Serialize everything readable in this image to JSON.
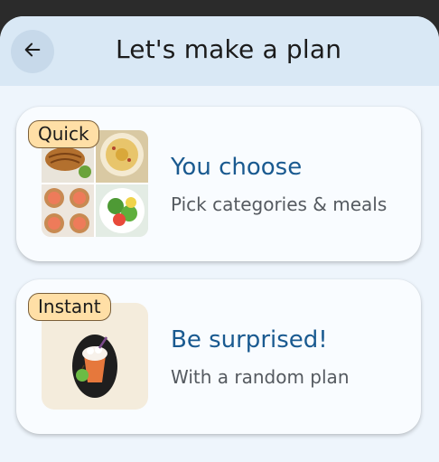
{
  "header": {
    "title": "Let's make a plan",
    "back_icon": "arrow-left-icon"
  },
  "cards": [
    {
      "badge": "Quick",
      "title": "You choose",
      "subtitle": "Pick categories & meals",
      "image": "food-collage-image"
    },
    {
      "badge": "Instant",
      "title": "Be surprised!",
      "subtitle": "With a random plan",
      "image": "random-meal-image"
    }
  ],
  "colors": {
    "title_blue": "#1a5a90",
    "badge_bg": "#ffdfa6",
    "header_bg": "#d9e8f5"
  }
}
